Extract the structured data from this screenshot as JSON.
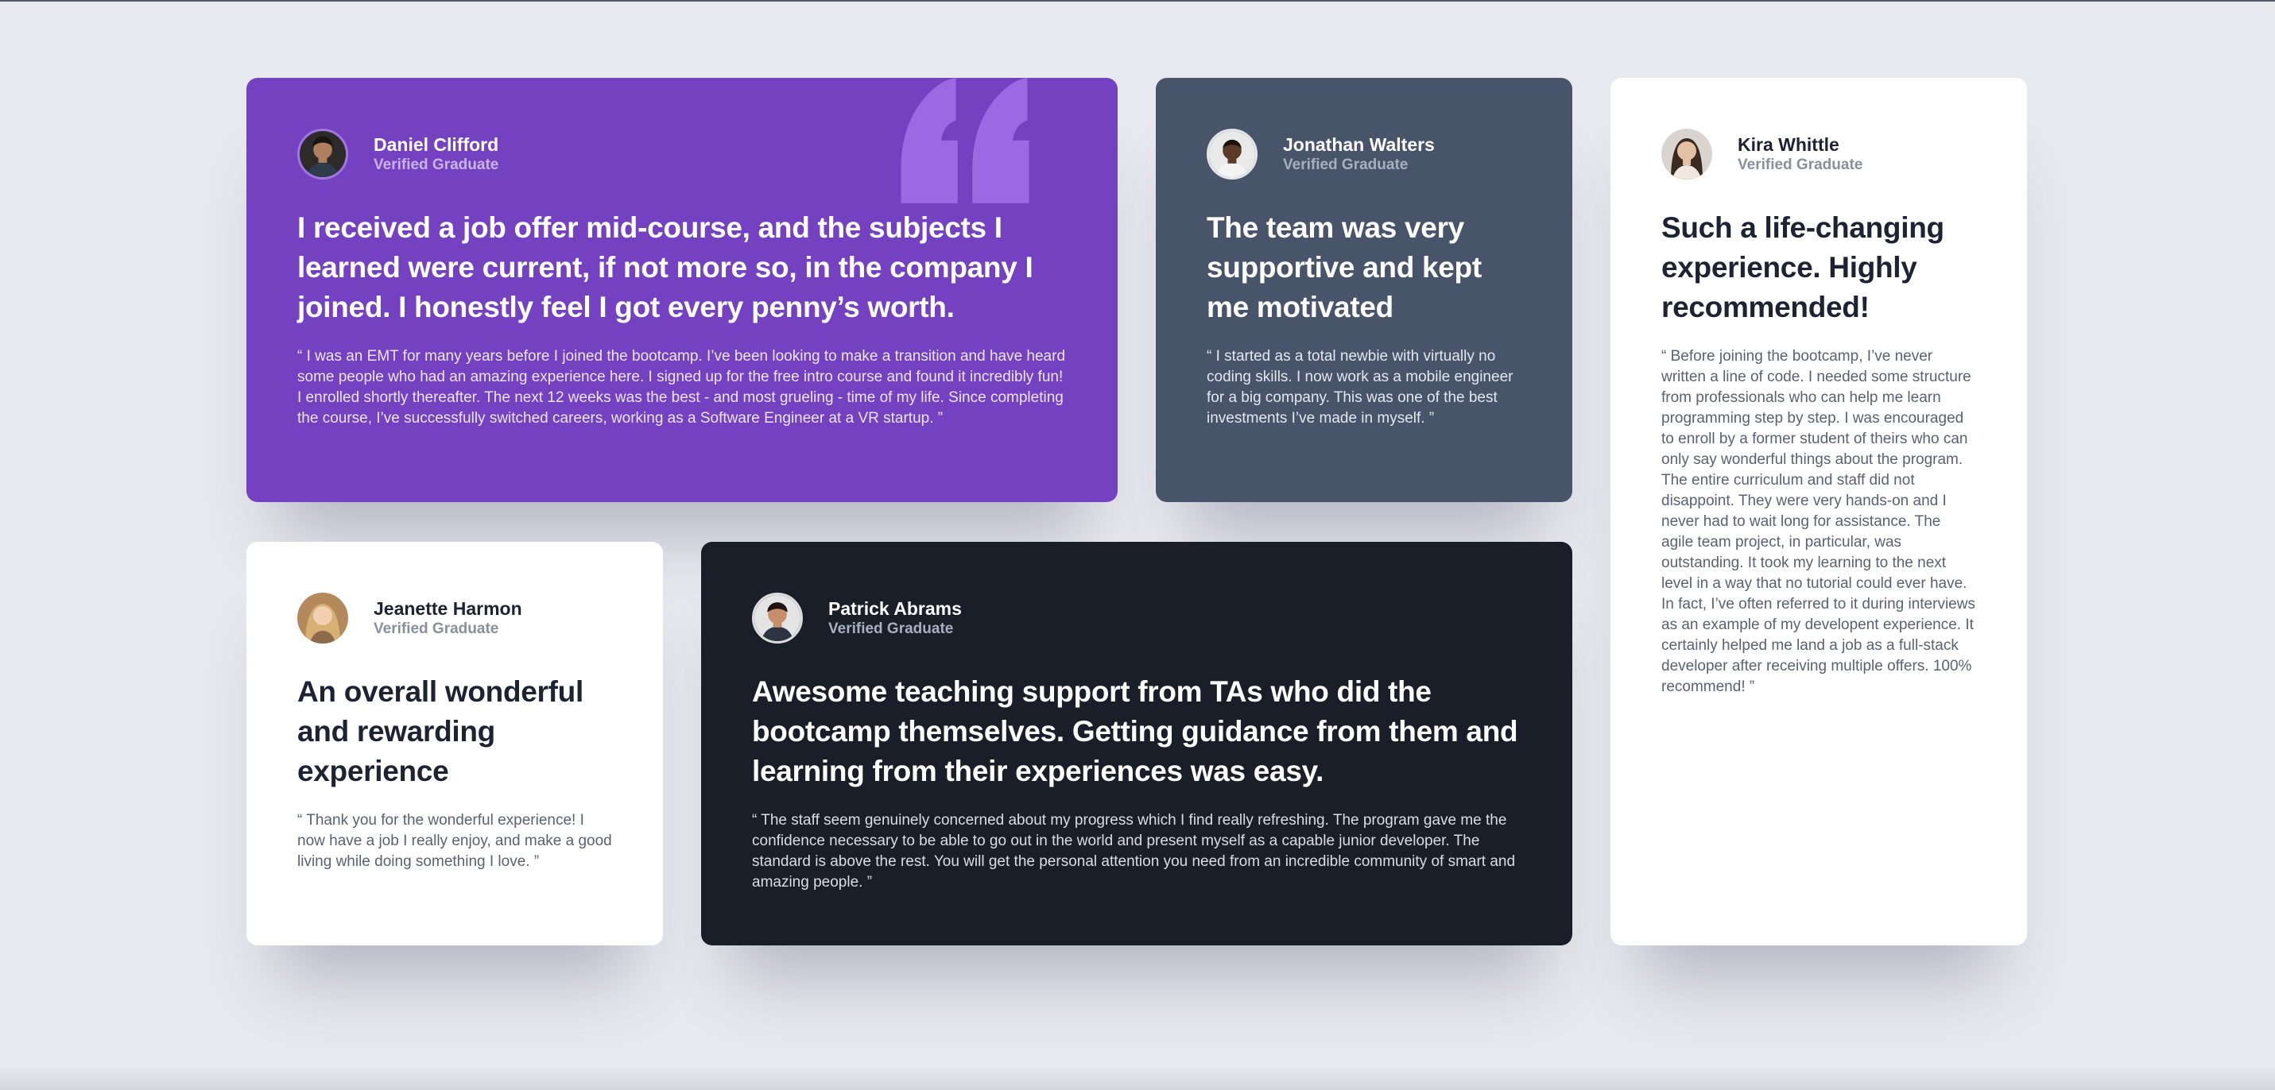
{
  "testimonials": [
    {
      "name": "Daniel Clifford",
      "role": "Verified Graduate",
      "title": "I received a job offer mid-course, and the subjects I learned were current, if not more so, in the company I joined. I honestly feel I got every penny’s worth.",
      "body": "“ I was an EMT for many years before I joined the bootcamp. I’ve been looking to make a transition and have heard some people who had an amazing experience here. I signed up for the free intro course and found it incredibly fun! I enrolled shortly thereafter. The next 12 weeks was the best - and most grueling - time of my life. Since completing the course, I’ve successfully switched careers, working as a Software Engineer at a VR startup. ”",
      "background": "#7442c1"
    },
    {
      "name": "Jonathan Walters",
      "role": "Verified Graduate",
      "title": "The team was very supportive and kept me motivated",
      "body": "“ I started as a total newbie with virtually no coding skills. I now work as a mobile engineer for a big company. This was one of the best investments I’ve made in myself. ”",
      "background": "#48546a"
    },
    {
      "name": "Kira Whittle",
      "role": "Verified Graduate",
      "title": "Such a life-changing experience. Highly recommended!",
      "body": "“ Before joining the bootcamp, I’ve never written a line of code. I needed some structure from professionals who can help me learn programming step by step. I was encouraged to enroll by a former student of theirs who can only say wonderful things about the program. The entire curriculum and staff did not disappoint. They were very hands-on and I never had to wait long for assistance. The agile team project, in particular, was outstanding. It took my learning to the next level in a way that no tutorial could ever have. In fact, I’ve often referred to it during interviews as an example of my developent experience. It certainly helped me land a job as a full-stack developer after receiving multiple offers. 100% recommend! ”",
      "background": "#ffffff"
    },
    {
      "name": "Jeanette Harmon",
      "role": "Verified Graduate",
      "title": "An overall wonderful and rewarding experience",
      "body": "“ Thank you for the wonderful experience! I now have a job I really enjoy, and make a good living while doing something I love. ”",
      "background": "#ffffff"
    },
    {
      "name": "Patrick Abrams",
      "role": "Verified Graduate",
      "title": "Awesome teaching support from TAs who did the bootcamp themselves. Getting guidance from them and learning from their experiences was easy.",
      "body": "“ The staff seem genuinely concerned about my progress which I find really refreshing. The program gave me the confidence necessary to be able to go out in the world and present myself as a capable junior developer. The standard is above the rest. You will get the personal attention you need from an incredible community of smart and amazing people. ”",
      "background": "#1a1e29"
    }
  ],
  "icons": {
    "quote": "quote-icon",
    "avatar": "avatar-photo"
  },
  "colors": {
    "page_background": "#e8e9ee",
    "accent_purple": "#7442c1",
    "quote_mark": "#9b6ae3"
  }
}
